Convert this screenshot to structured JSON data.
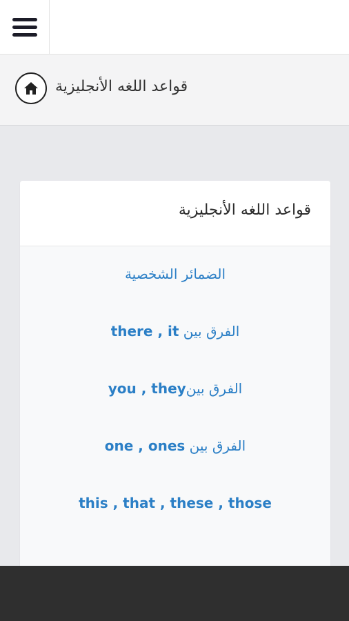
{
  "header": {
    "menu_icon": "hamburger-menu-icon"
  },
  "breadcrumb": {
    "home_icon": "home-icon",
    "label": "قواعد اللغه الأنجليزية"
  },
  "card": {
    "title": "قواعد اللغه الأنجليزية",
    "links": [
      {
        "text": "الضمائر الشخصية"
      },
      {
        "prefix": "الفرق بين",
        "terms": "there , it"
      },
      {
        "prefix": "الفرق بين",
        "terms": "you , they"
      },
      {
        "prefix": "الفرق بين",
        "terms": "one , ones"
      },
      {
        "text": "this , that , these , those"
      }
    ]
  },
  "colors": {
    "link": "#2b7fc6",
    "bottom_bar": "#2f2f2f",
    "page_bg": "#e8e9ec"
  }
}
